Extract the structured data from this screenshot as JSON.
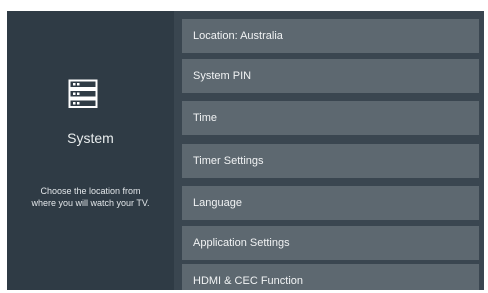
{
  "left_panel": {
    "title": "System",
    "description_line1": "Choose the location from",
    "description_line2": "where you will watch your TV.",
    "icon": "server-icon"
  },
  "menu": {
    "items": [
      {
        "label": "Location: Australia"
      },
      {
        "label": "System PIN"
      },
      {
        "label": "Time"
      },
      {
        "label": "Timer Settings"
      },
      {
        "label": "Language"
      },
      {
        "label": "Application Settings"
      },
      {
        "label": "HDMI & CEC Function"
      }
    ]
  },
  "colors": {
    "panel_background": "#2f3b45",
    "menu_background": "#3a4650",
    "item_background": "#5d6870",
    "text": "#f1f3f4"
  }
}
